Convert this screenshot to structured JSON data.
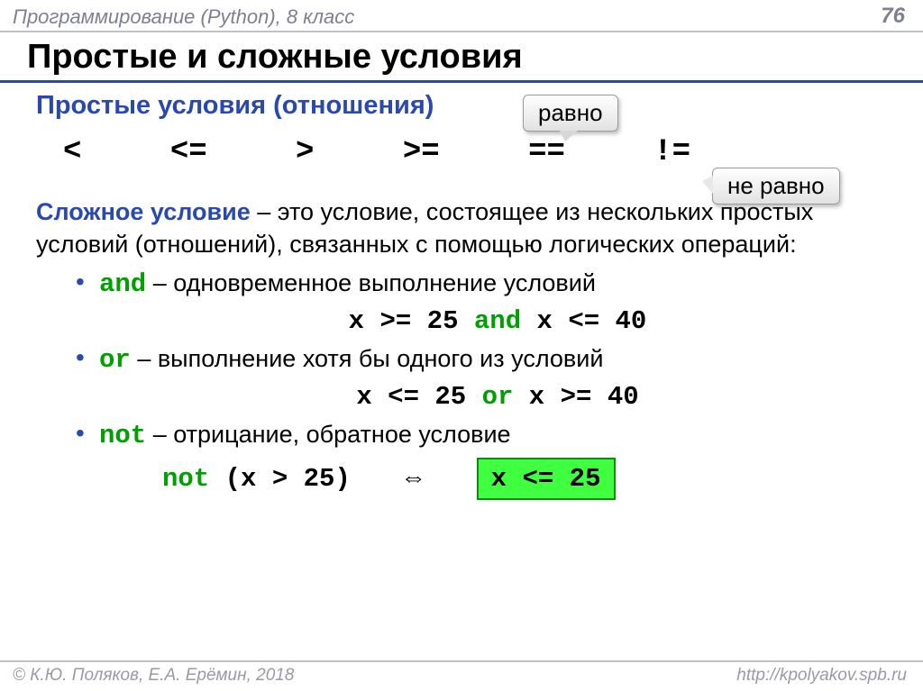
{
  "header": {
    "course": "Программирование (Python), 8 класс",
    "page": "76"
  },
  "title": "Простые и сложные условия",
  "section1_heading": "Простые условия (отношения)",
  "callouts": {
    "equal": "равно",
    "not_equal": "не равно"
  },
  "operators": [
    "<",
    "<=",
    ">",
    ">=",
    "==",
    "!="
  ],
  "complex": {
    "lead_bold": "Сложное условие",
    "lead_rest": " – это условие, состоящее из нескольких простых условий (отношений), связанных с помощью логических операций:",
    "items": [
      {
        "kw": "and",
        "desc": " – одновременное выполнение условий",
        "code_pre": "x >= 25 ",
        "code_kw": "and",
        "code_post": " x <= 40"
      },
      {
        "kw": "or",
        "desc": " – выполнение хотя бы одного из условий",
        "code_pre": "x <= 25 ",
        "code_kw": "or",
        "code_post": " x >= 40"
      },
      {
        "kw": "not",
        "desc": " – отрицание, обратное условие",
        "not_code_kw": "not",
        "not_code_rest": " (x > 25)",
        "arrow": "⇔",
        "box": "x <= 25"
      }
    ]
  },
  "footer": {
    "left": "© К.Ю. Поляков, Е.А. Ерёмин, 2018",
    "right": "http://kpolyakov.spb.ru"
  }
}
